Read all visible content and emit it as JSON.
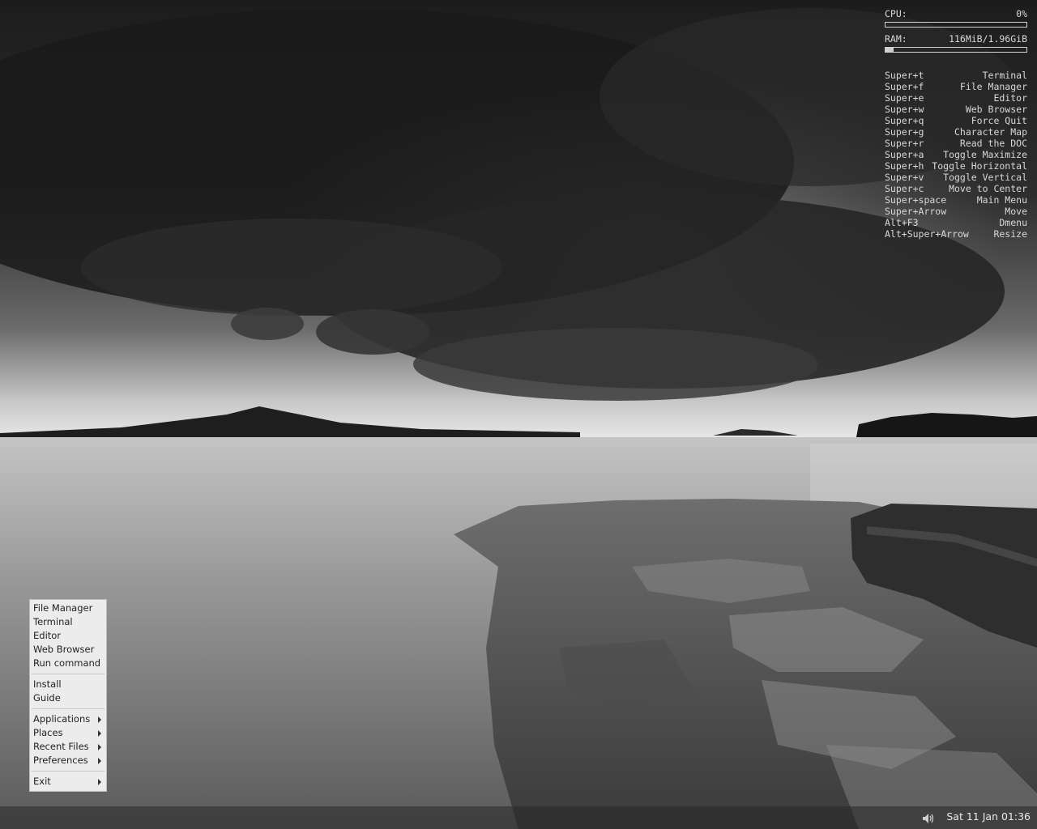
{
  "conky": {
    "cpu_label": "CPU:",
    "cpu_value": "0%",
    "cpu_fraction": 0.0,
    "ram_label": "RAM:",
    "ram_value": "116MiB/1.96GiB",
    "ram_fraction": 0.06,
    "shortcuts": [
      {
        "key": "Super+t",
        "action": "Terminal"
      },
      {
        "key": "Super+f",
        "action": "File Manager"
      },
      {
        "key": "Super+e",
        "action": "Editor"
      },
      {
        "key": "Super+w",
        "action": "Web Browser"
      },
      {
        "key": "Super+q",
        "action": "Force Quit"
      },
      {
        "key": "Super+g",
        "action": "Character Map"
      },
      {
        "key": "Super+r",
        "action": "Read the DOC"
      },
      {
        "key": "Super+a",
        "action": "Toggle Maximize"
      },
      {
        "key": "Super+h",
        "action": "Toggle Horizontal"
      },
      {
        "key": "Super+v",
        "action": "Toggle Vertical"
      },
      {
        "key": "Super+c",
        "action": "Move to Center"
      },
      {
        "key": "Super+space",
        "action": "Main Menu"
      },
      {
        "key": "Super+Arrow",
        "action": "Move"
      },
      {
        "key": "Alt+F3",
        "action": "Dmenu"
      },
      {
        "key": "Alt+Super+Arrow",
        "action": "Resize"
      }
    ]
  },
  "menu": {
    "group1": [
      "File Manager",
      "Terminal",
      "Editor",
      "Web Browser",
      "Run command"
    ],
    "group2": [
      "Install",
      "Guide"
    ],
    "group3": [
      "Applications",
      "Places",
      "Recent Files",
      "Preferences"
    ],
    "exit": "Exit"
  },
  "panel": {
    "clock": "Sat 11 Jan 01:36",
    "volume_icon": "speaker-icon"
  }
}
